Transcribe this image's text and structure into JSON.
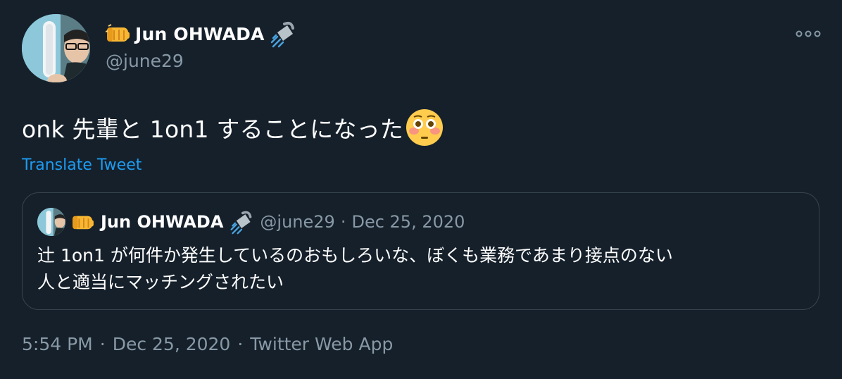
{
  "author": {
    "name": "Jun OHWADA",
    "handle": "@june29",
    "name_prefix_icon": "oncoming-fist-emoji",
    "name_suffix_icon": "shower-emoji"
  },
  "menu": {
    "more_icon": "more-horizontal-icon"
  },
  "tweet": {
    "text": "onk 先輩と 1on1 することになった",
    "trailing_emoji": "flushed-face-emoji",
    "translate_label": "Translate Tweet"
  },
  "quote": {
    "name": "Jun OHWADA",
    "handle": "@june29",
    "separator": "·",
    "date": "Dec 25, 2020",
    "line1": "辻 1on1 が何件か発生しているのおもしろいな、ぼくも業務であまり接点のない",
    "line2": "人と適当にマッチングされたい"
  },
  "meta": {
    "time": "5:54 PM",
    "separator1": "·",
    "date": "Dec 25, 2020",
    "separator2": "·",
    "source": "Twitter Web App"
  },
  "colors": {
    "background": "#15202b",
    "text_primary": "#ffffff",
    "text_secondary": "#8899a6",
    "link": "#1d9bf0",
    "border": "#38444d"
  }
}
